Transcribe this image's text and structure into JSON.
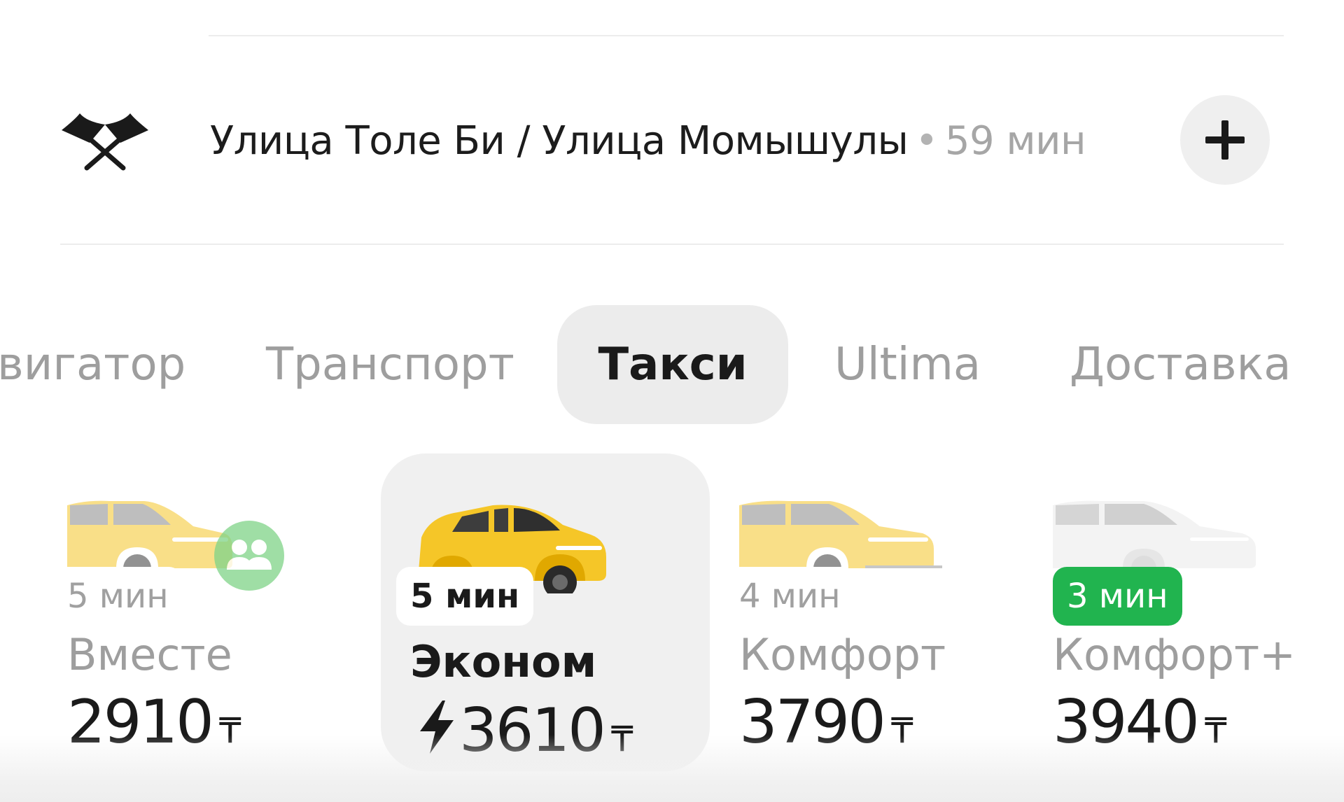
{
  "destination": {
    "address": "Улица Толе Би / Улица Момышулы",
    "separator": "•",
    "eta": "59 мин"
  },
  "tabs": [
    {
      "label": "вигатор"
    },
    {
      "label": "Транспорт"
    },
    {
      "label": "Такси"
    },
    {
      "label": "Ultima"
    },
    {
      "label": "Доставка"
    }
  ],
  "tariffs": [
    {
      "eta": "5 мин",
      "name": "Вместе",
      "price": "2910",
      "currency": "₸"
    },
    {
      "eta": "5 мин",
      "name": "Эконом",
      "price": "3610",
      "currency": "₸"
    },
    {
      "eta": "4 мин",
      "name": "Комфорт",
      "price": "3790",
      "currency": "₸"
    },
    {
      "eta": "3 мин",
      "name": "Комфорт+",
      "price": "3940",
      "currency": "₸"
    }
  ],
  "selected_tab": "Такси",
  "selected_tariff": "Эконом",
  "colors": {
    "taxi_yellow": "#f5c628",
    "badge_green": "#21b44f",
    "group_green": "#7fd488",
    "selected_bg": "#f0f0f0"
  },
  "icons": {
    "destination": "finish-flags-icon",
    "add": "plus-icon",
    "surge": "lightning-bolt-icon",
    "shared_ride": "group-people-icon"
  }
}
